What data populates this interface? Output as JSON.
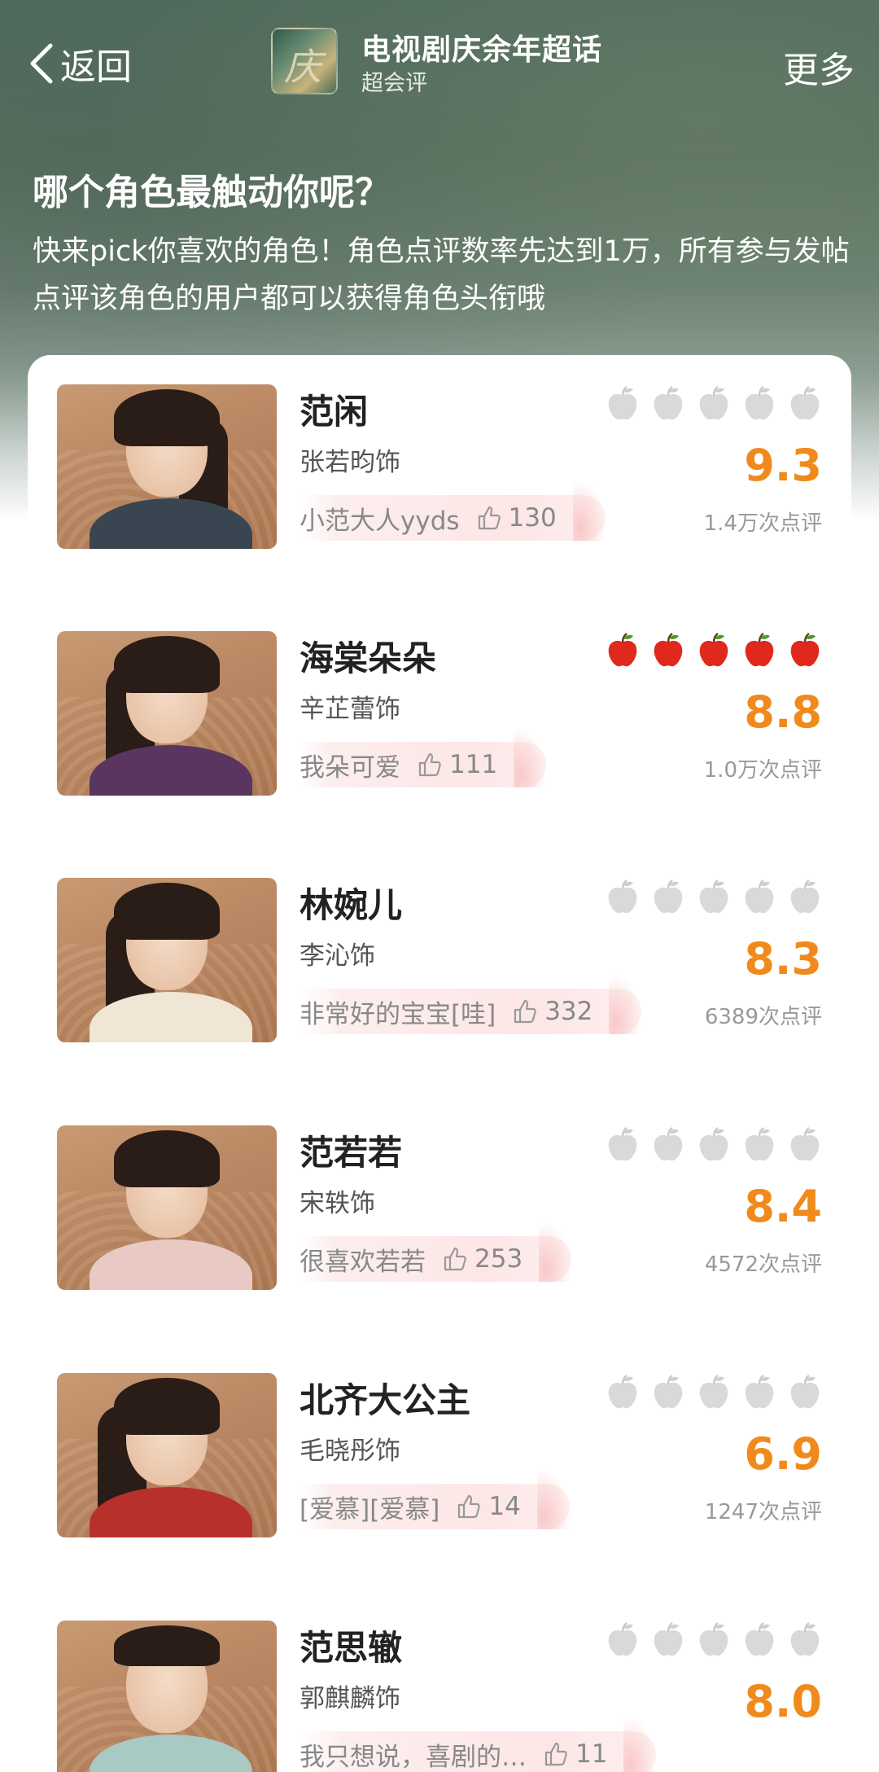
{
  "nav": {
    "back_label": "返回",
    "group_title": "电视剧庆余年超话",
    "group_subtitle": "超会评",
    "more_label": "更多"
  },
  "header": {
    "heading": "哪个角色最触动你呢？",
    "description": "快来pick你喜欢的角色！角色点评数率先达到1万，所有参与发帖点评该角色的用户都可以获得角色头衔哦"
  },
  "colors": {
    "accent_score": "#f08a1c",
    "apple_active": "#e0281c",
    "apple_inactive": "#d9d9d9"
  },
  "characters": [
    {
      "name": "范闲",
      "actor": "张若昀饰",
      "comment": "小范大人yyds",
      "likes": "130",
      "score": "9.3",
      "reviews": "1.4万次点评",
      "apples_active": false,
      "outfit": "#3a4552"
    },
    {
      "name": "海棠朵朵",
      "actor": "辛芷蕾饰",
      "comment": "我朵可爱",
      "likes": "111",
      "score": "8.8",
      "reviews": "1.0万次点评",
      "apples_active": true,
      "outfit": "#5a3560"
    },
    {
      "name": "林婉儿",
      "actor": "李沁饰",
      "comment": "非常好的宝宝[哇]",
      "likes": "332",
      "score": "8.3",
      "reviews": "6389次点评",
      "apples_active": false,
      "outfit": "#efe6d6"
    },
    {
      "name": "范若若",
      "actor": "宋轶饰",
      "comment": "很喜欢若若",
      "likes": "253",
      "score": "8.4",
      "reviews": "4572次点评",
      "apples_active": false,
      "outfit": "#e9c9c3"
    },
    {
      "name": "北齐大公主",
      "actor": "毛晓彤饰",
      "comment": "[爱慕][爱慕]",
      "likes": "14",
      "score": "6.9",
      "reviews": "1247次点评",
      "apples_active": false,
      "outfit": "#b8302a"
    },
    {
      "name": "范思辙",
      "actor": "郭麒麟饰",
      "comment": "我只想说，喜剧的…",
      "likes": "11",
      "score": "8.0",
      "reviews": "",
      "apples_active": false,
      "outfit": "#a9c9c4"
    }
  ]
}
